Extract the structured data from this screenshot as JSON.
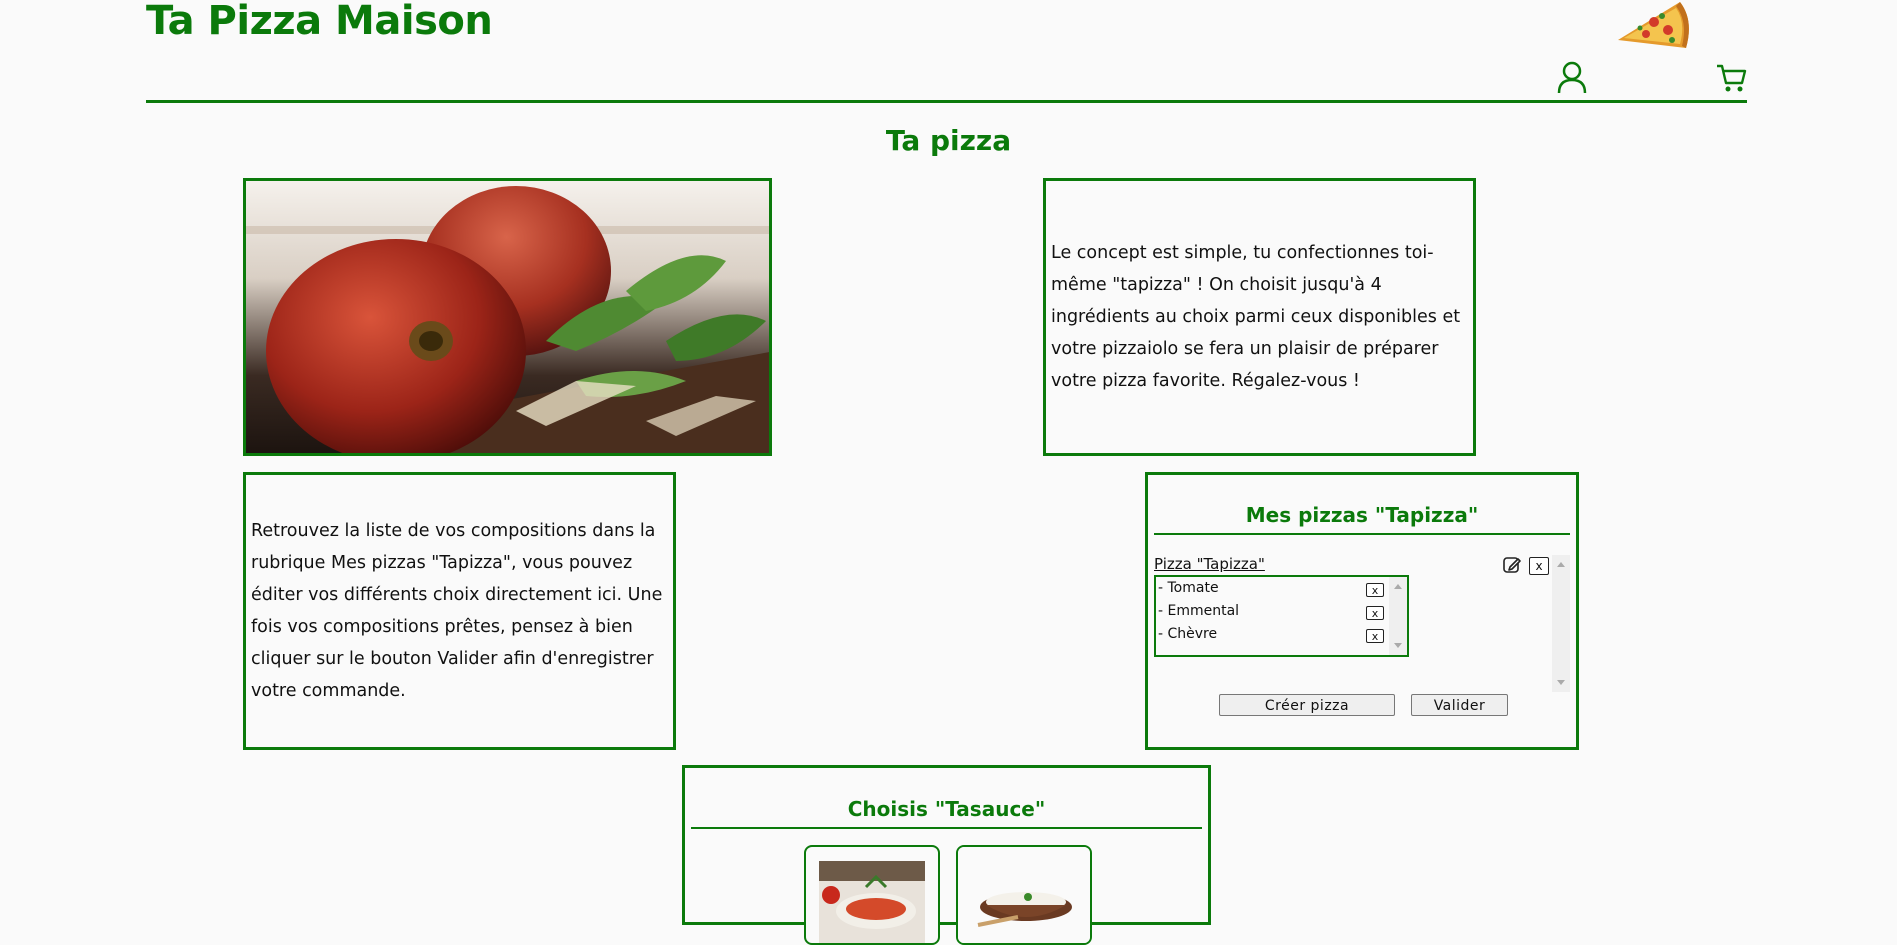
{
  "header": {
    "site_title": "Ta Pizza Maison",
    "logo_icon": "pizza-slice-logo",
    "user_icon": "user-icon",
    "cart_icon": "cart-icon"
  },
  "page": {
    "heading": "Ta pizza"
  },
  "intro": {
    "text": "Le concept est simple, tu confectionnes toi-même \"tapizza\" ! On choisit jusqu'à 4 ingrédients au choix parmi ceux disponibles et votre pizzaiolo se fera un plaisir de préparer votre pizza favorite. Régalez-vous !"
  },
  "help": {
    "text": "Retrouvez la liste de vos compositions dans la rubrique Mes pizzas \"Tapizza\", vous pouvez éditer vos différents choix directement ici. Une fois vos compositions prêtes, pensez à bien cliquer sur le bouton Valider afin d'enregistrer votre commande."
  },
  "my_pizzas": {
    "title": "Mes pizzas \"Tapizza\"",
    "pizza_label": "Pizza \"Tapizza\"",
    "delete_label": "x",
    "ingredients": [
      {
        "label": "- Tomate",
        "remove": "x"
      },
      {
        "label": "- Emmental",
        "remove": "x"
      },
      {
        "label": "- Chèvre",
        "remove": "x"
      }
    ],
    "create_button": "Créer pizza",
    "validate_button": "Valider"
  },
  "sauce": {
    "title": "Choisis \"Tasauce\""
  },
  "colors": {
    "accent": "#0b7a0b",
    "background": "#fafafa"
  }
}
